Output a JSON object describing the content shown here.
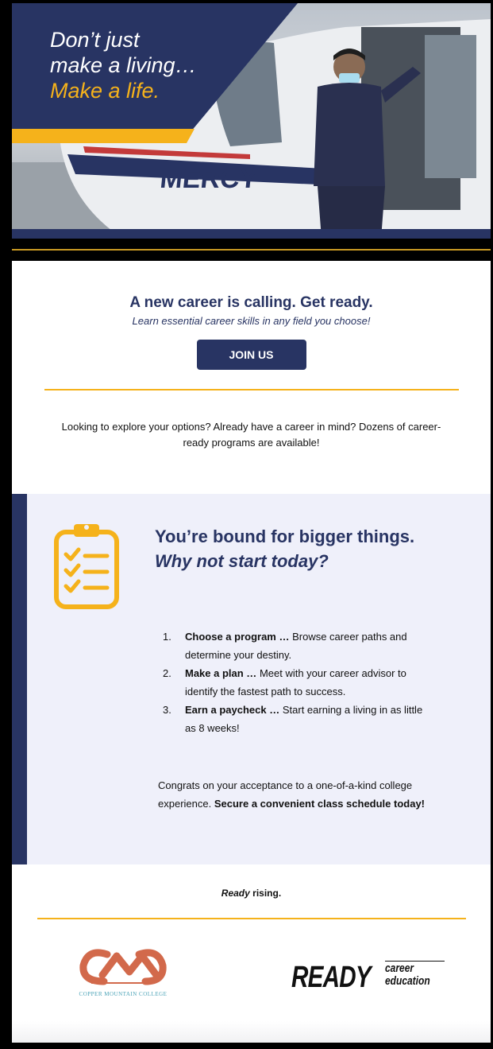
{
  "hero": {
    "line1": "Don’t just",
    "line2": "make a living…",
    "line3": "Make a life.",
    "helicopter_text": "MERCY"
  },
  "cta": {
    "title": "A new career is calling. Get ready.",
    "subtitle": "Learn essential career skills in any field you choose!",
    "button_label": "JOIN US"
  },
  "explore": {
    "text": "Looking to explore your options? Already have a career in mind? Dozens of career-ready programs are available!"
  },
  "promo": {
    "heading_plain": "You’re bound for bigger things.",
    "heading_italic": "Why not start today?",
    "steps": [
      {
        "num": "1.",
        "bold": "Choose a program …",
        "text": "Browse career paths and determine your destiny."
      },
      {
        "num": "2.",
        "bold": "Make a plan …",
        "text": "Meet with your career advisor to identify the fastest path to success."
      },
      {
        "num": "3.",
        "bold": "Earn a paycheck …",
        "text": "Start earning a living in as little as 8 weeks!"
      }
    ],
    "congrats_plain": "Congrats on your acceptance to a one-of-a-kind college experience.",
    "congrats_bold": "Secure a convenient class schedule today!"
  },
  "footer": {
    "tagline_italic": "Ready",
    "tagline_rest": "rising.",
    "cmc_caption": "COPPER MOUNTAIN COLLEGE",
    "ready_word": "READY",
    "ready_line1": "career",
    "ready_line2": "education"
  },
  "colors": {
    "navy": "#283463",
    "gold": "#f5b21b",
    "promo_bg": "#eff0fa"
  }
}
